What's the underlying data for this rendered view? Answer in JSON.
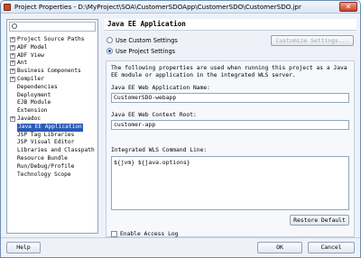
{
  "window": {
    "title": "Project Properties - D:\\MyProject\\SOA\\CustomerSDOApp\\CustomerSDO\\CustomerSDO.jpr",
    "close_label": "✕"
  },
  "sidebar": {
    "search_placeholder": "",
    "items": [
      {
        "label": "Project Source Paths",
        "expander": "+"
      },
      {
        "label": "ADF Model",
        "expander": "+"
      },
      {
        "label": "ADF View",
        "expander": "+"
      },
      {
        "label": "Ant",
        "expander": "+"
      },
      {
        "label": "Business Components",
        "expander": "+"
      },
      {
        "label": "Compiler",
        "expander": "+"
      },
      {
        "label": "Dependencies",
        "expander": ""
      },
      {
        "label": "Deployment",
        "expander": ""
      },
      {
        "label": "EJB Module",
        "expander": ""
      },
      {
        "label": "Extension",
        "expander": ""
      },
      {
        "label": "Javadoc",
        "expander": "+"
      },
      {
        "label": "Java EE Application",
        "expander": "",
        "selected": true
      },
      {
        "label": "JSP Tag Libraries",
        "expander": ""
      },
      {
        "label": "JSP Visual Editor",
        "expander": ""
      },
      {
        "label": "Libraries and Classpath",
        "expander": ""
      },
      {
        "label": "Resource Bundle",
        "expander": ""
      },
      {
        "label": "Run/Debug/Profile",
        "expander": ""
      },
      {
        "label": "Technology Scope",
        "expander": ""
      }
    ]
  },
  "main": {
    "header_title": "Java EE Application",
    "radio_custom": "Use Custom Settings",
    "radio_project": "Use Project Settings",
    "customize_button": "Customize Settings...",
    "description": "The following properties are used when running this project as a Java EE module or application in the integrated WLS server.",
    "web_app_name_label": "Java EE Web Application Name:",
    "web_app_name_value": "CustomerSDO-webapp",
    "context_root_label": "Java EE Web Context Root:",
    "context_root_value": "customer-app",
    "wls_cmd_label": "Integrated WLS Command Line:",
    "wls_cmd_value": "${jvm} ${java.options}",
    "restore_button": "Restore Default",
    "enable_access_log": "Enable Access Log"
  },
  "footer": {
    "help_button": "Help",
    "ok_button": "OK",
    "cancel_button": "Cancel"
  }
}
